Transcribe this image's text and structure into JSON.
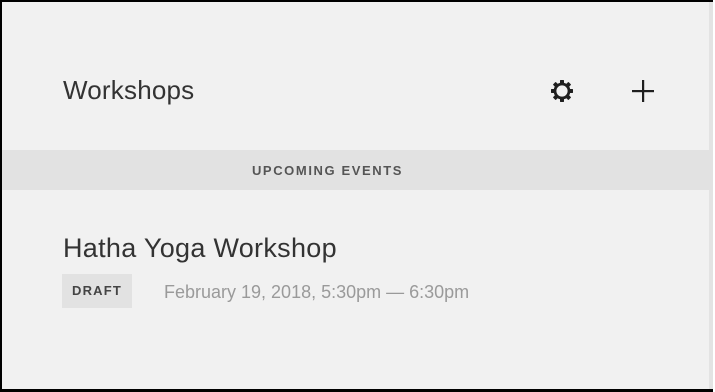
{
  "header": {
    "title": "Workshops",
    "settings_icon": "gear-icon",
    "add_icon": "plus-icon"
  },
  "section": {
    "label": "UPCOMING EVENTS"
  },
  "events": [
    {
      "title": "Hatha Yoga Workshop",
      "status": "DRAFT",
      "datetime": "February 19, 2018, 5:30pm — 6:30pm"
    }
  ],
  "colors": {
    "background": "#f1f1f1",
    "section_bar": "#e2e2e2",
    "text_primary": "#333333",
    "text_muted": "#9a9a9a"
  }
}
